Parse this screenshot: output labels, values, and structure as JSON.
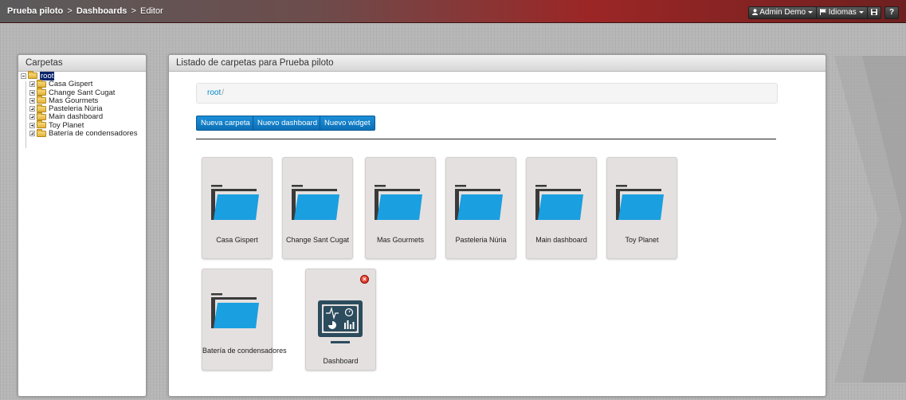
{
  "topbar": {
    "breadcrumb": [
      "Prueba piloto",
      "Dashboards",
      "Editor"
    ],
    "separator": ">",
    "user_menu": "Admin Demo",
    "language_menu": "Idiomas",
    "help_label": "?"
  },
  "left_panel": {
    "title": "Carpetas",
    "tree_root": "root",
    "tree_items": [
      {
        "label": "Casa Gispert"
      },
      {
        "label": "Change Sant Cugat"
      },
      {
        "label": "Mas Gourmets"
      },
      {
        "label": "Pasteleria Núria"
      },
      {
        "label": "Main dashboard"
      },
      {
        "label": "Toy Planet"
      },
      {
        "label": "Batería de condensadores"
      }
    ]
  },
  "main": {
    "title": "Listado de carpetas para Prueba piloto",
    "path_root": "root",
    "path_separator": "/",
    "buttons": {
      "new_folder": "Nueva carpeta",
      "new_dashboard": "Nuevo dashboard",
      "new_widget": "Nuevo widget"
    },
    "folders": [
      {
        "label": "Casa Gispert"
      },
      {
        "label": "Change Sant Cugat"
      },
      {
        "label": "Mas Gourmets"
      },
      {
        "label": "Pasteleria Núria"
      },
      {
        "label": "Main dashboard"
      },
      {
        "label": "Toy Planet"
      },
      {
        "label": "Batería de condensadores"
      }
    ],
    "dashboards": [
      {
        "label": "Dashboard",
        "icon": "dashboard-monitor-icon",
        "delete_icon": "delete-icon"
      }
    ]
  },
  "colors": {
    "folder_blue": "#1a9fe0",
    "folder_tab": "#3a3a3a",
    "button_blue": "#1479c4",
    "topbar_red": "#9c2626",
    "tile_bg": "#e4e0df",
    "delete_red": "#d62b1c"
  }
}
